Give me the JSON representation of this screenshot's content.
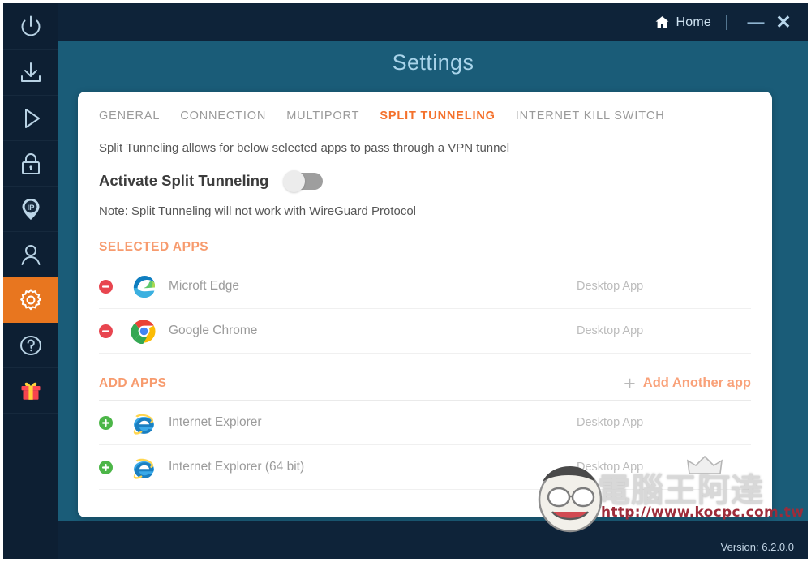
{
  "window": {
    "title": "Settings",
    "version_label": "Version: 6.2.0.0"
  },
  "titlebar": {
    "home_label": "Home",
    "home_icon": "house-icon",
    "minimize_glyph": "—",
    "close_glyph": "✕"
  },
  "sidebar": {
    "items": [
      {
        "name": "power",
        "icon": "power-icon",
        "active": false
      },
      {
        "name": "download",
        "icon": "download-icon",
        "active": false
      },
      {
        "name": "play",
        "icon": "play-icon",
        "active": false
      },
      {
        "name": "lock",
        "icon": "lock-icon",
        "active": false
      },
      {
        "name": "ip",
        "icon": "ip-pin-icon",
        "active": false
      },
      {
        "name": "account",
        "icon": "user-icon",
        "active": false
      },
      {
        "name": "settings",
        "icon": "gear-icon",
        "active": true
      },
      {
        "name": "help",
        "icon": "question-circle-icon",
        "active": false
      },
      {
        "name": "gift",
        "icon": "gift-icon",
        "active": false
      }
    ],
    "active_color": "#e8761f",
    "background": "#0d1f33"
  },
  "tabs": [
    {
      "label": "GENERAL",
      "active": false
    },
    {
      "label": "CONNECTION",
      "active": false
    },
    {
      "label": "MULTIPORT",
      "active": false
    },
    {
      "label": "SPLIT TUNNELING",
      "active": true
    },
    {
      "label": "INTERNET KILL SWITCH",
      "active": false
    }
  ],
  "split_tunneling": {
    "description": "Split Tunneling allows for below selected apps to pass through a VPN tunnel",
    "activate_label": "Activate Split Tunneling",
    "activate_enabled": false,
    "note": "Note: Split Tunneling will not work with WireGuard Protocol"
  },
  "selected_apps": {
    "title": "SELECTED APPS",
    "rows": [
      {
        "name": "Microft Edge",
        "type": "Desktop App",
        "icon": "edge-icon",
        "action": "remove-icon"
      },
      {
        "name": "Google Chrome",
        "type": "Desktop App",
        "icon": "chrome-icon",
        "action": "remove-icon"
      }
    ]
  },
  "add_apps": {
    "title": "ADD APPS",
    "add_another_label": "Add Another app",
    "add_another_icon": "plus-icon",
    "rows": [
      {
        "name": "Internet Explorer",
        "type": "Desktop App",
        "icon": "ie-icon",
        "action": "add-icon"
      },
      {
        "name": "Internet Explorer (64 bit)",
        "type": "Desktop App",
        "icon": "ie-icon",
        "action": "add-icon"
      }
    ]
  },
  "watermark": {
    "text": "電腦王阿達",
    "url": "http://www.kocpc.com.tw"
  },
  "colors": {
    "accent_orange": "#f4712c",
    "section_orange": "#f79b6e",
    "titlebar": "#0e2339",
    "body_bg": "#1a5c78",
    "card": "#ffffff"
  }
}
